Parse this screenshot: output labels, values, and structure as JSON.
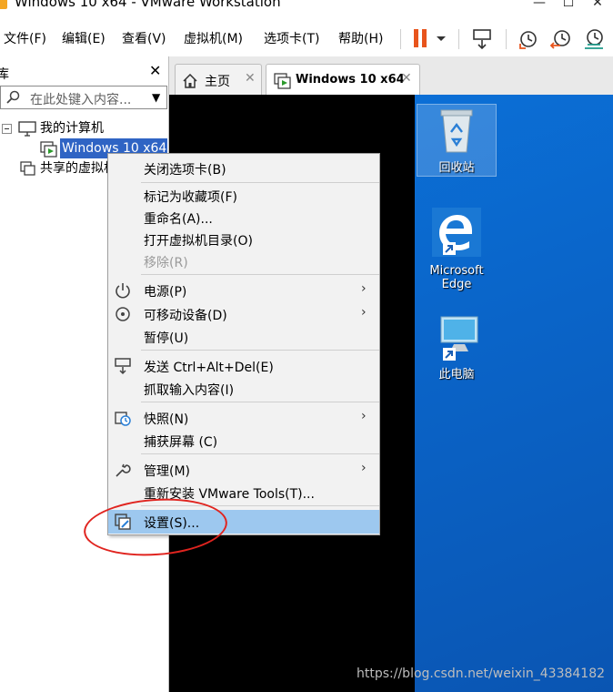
{
  "window": {
    "title": "Windows 10 x64 - VMware Workstation"
  },
  "menubar": {
    "items": [
      "文件(F)",
      "编辑(E)",
      "查看(V)",
      "虚拟机(M)",
      "选项卡(T)",
      "帮助(H)"
    ],
    "toolbar_icons": [
      "pause-icon",
      "chevron-down-icon",
      "send-ctrl-alt-del-icon",
      "snapshot-icon",
      "revert-snapshot-icon",
      "snapshot-manager-icon"
    ],
    "pause_color": "#e8541c"
  },
  "library": {
    "title": "库",
    "search_placeholder": "在此处键入内容...",
    "tree": {
      "my_computer": "我的计算机",
      "vm": "Windows 10 x64",
      "shared": "共享的虚拟机"
    }
  },
  "tabs": [
    {
      "label": "主页"
    },
    {
      "label": "Windows 10 x64"
    }
  ],
  "desktop": {
    "icons": [
      {
        "label": "回收站",
        "icon": "recycle-bin-icon"
      },
      {
        "label": "Microsoft Edge",
        "icon": "edge-icon"
      },
      {
        "label": "此电脑",
        "icon": "this-pc-icon"
      }
    ],
    "background_color": "#0a64c8"
  },
  "context_menu": {
    "close_tab": "关闭选项卡(B)",
    "mark_favorite": "标记为收藏项(F)",
    "rename": "重命名(A)...",
    "open_vm_dir": "打开虚拟机目录(O)",
    "remove": "移除(R)",
    "power": "电源(P)",
    "removable_devices": "可移动设备(D)",
    "pause": "暂停(U)",
    "send_cad": "发送 Ctrl+Alt+Del(E)",
    "grab_input": "抓取输入内容(I)",
    "snapshot": "快照(N)",
    "capture_screen": "捕获屏幕 (C)",
    "manage": "管理(M)",
    "reinstall_tools": "重新安装 VMware Tools(T)...",
    "settings": "设置(S)...",
    "highlight_color": "#9dc8ef"
  },
  "annotation": {
    "circle_color": "#e0241f"
  },
  "watermark": "https://blog.csdn.net/weixin_43384182"
}
